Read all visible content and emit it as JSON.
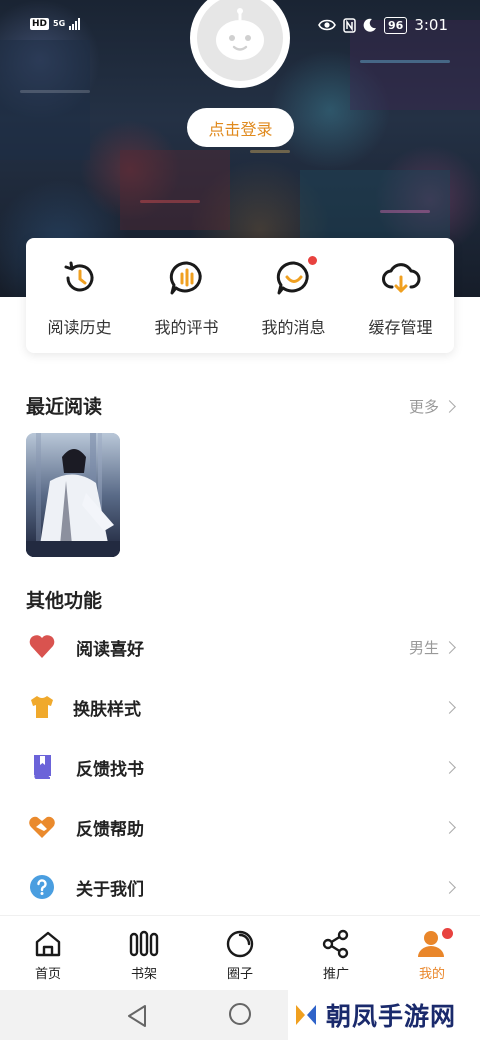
{
  "status_bar": {
    "hd": "HD",
    "network": "5G",
    "battery": "96",
    "time": "3:01"
  },
  "profile": {
    "login_label": "点击登录"
  },
  "quick_actions": [
    {
      "label": "阅读历史",
      "icon": "history-clock-icon"
    },
    {
      "label": "我的评书",
      "icon": "comment-bars-icon"
    },
    {
      "label": "我的消息",
      "icon": "message-smile-icon",
      "has_dot": true
    },
    {
      "label": "缓存管理",
      "icon": "cloud-download-icon"
    }
  ],
  "recent": {
    "title": "最近阅读",
    "more_label": "更多"
  },
  "other": {
    "title": "其他功能",
    "items": [
      {
        "label": "阅读喜好",
        "value": "男生",
        "icon": "heart-icon",
        "color": "#d9534f"
      },
      {
        "label": "换肤样式",
        "value": "",
        "icon": "tshirt-icon",
        "color": "#f0a92c"
      },
      {
        "label": "反馈找书",
        "value": "",
        "icon": "book-icon",
        "color": "#6b63d9"
      },
      {
        "label": "反馈帮助",
        "value": "",
        "icon": "handshake-icon",
        "color": "#ea8a2d"
      },
      {
        "label": "关于我们",
        "value": "",
        "icon": "question-icon",
        "color": "#4a9ee0"
      }
    ]
  },
  "tabbar": {
    "items": [
      {
        "label": "首页",
        "icon": "home-icon"
      },
      {
        "label": "书架",
        "icon": "bookshelf-icon"
      },
      {
        "label": "圈子",
        "icon": "circle-icon"
      },
      {
        "label": "推广",
        "icon": "share-icon"
      },
      {
        "label": "我的",
        "icon": "profile-icon",
        "active": true,
        "has_dot": true
      }
    ],
    "accent": "#e9862a"
  },
  "watermark": {
    "text": "朝凤手游网"
  }
}
